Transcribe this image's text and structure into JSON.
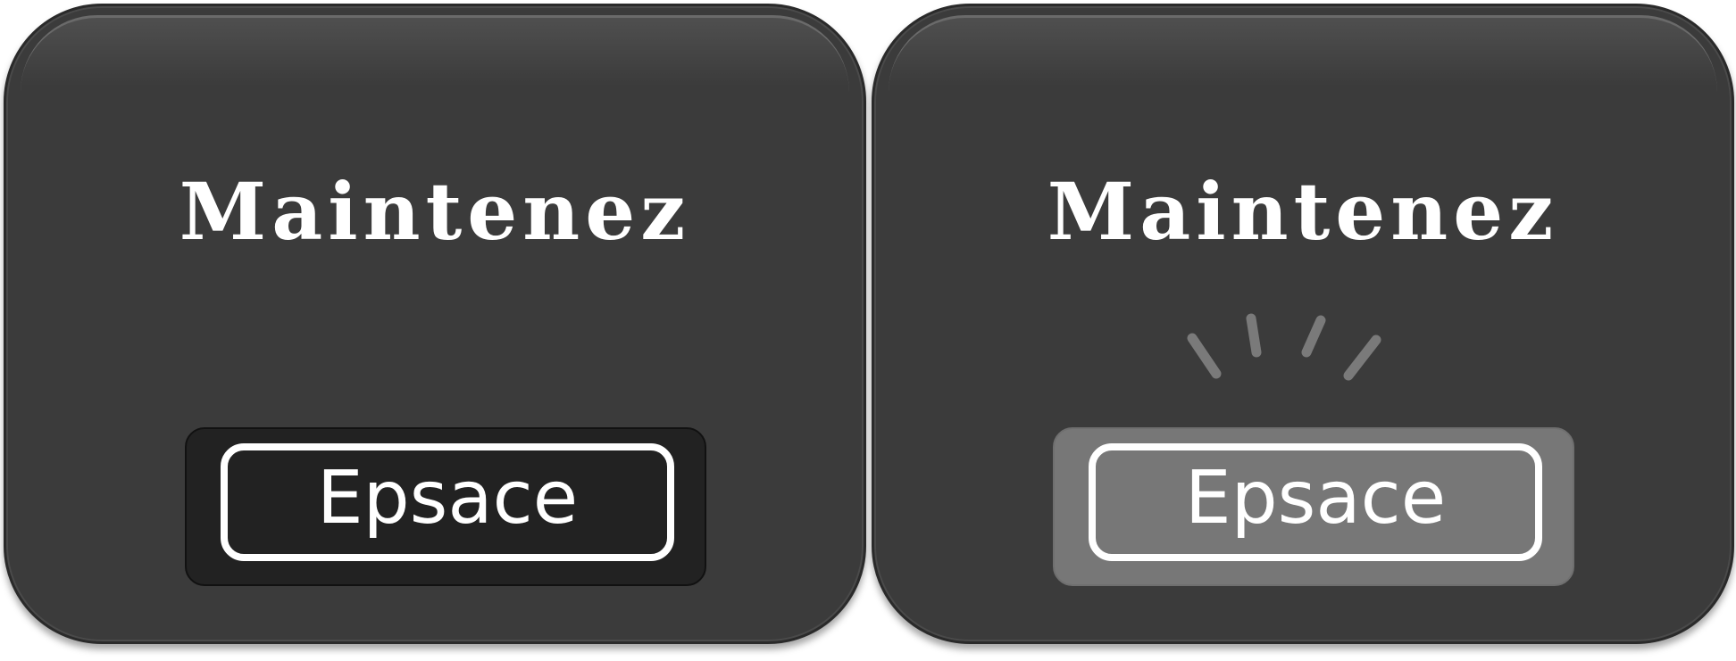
{
  "panels": [
    {
      "state": "released",
      "title": "Maintenez",
      "key_label": "Epsace"
    },
    {
      "state": "pressed",
      "title": "Maintenez",
      "key_label": "Epsace",
      "press_icon": "press-burst-icon"
    }
  ],
  "colors": {
    "panel_bg": "#3b3b3b",
    "key_up_bg": "#222222",
    "key_down_bg": "#777777",
    "text": "#ffffff",
    "press_marks": "#7a7a7a"
  }
}
